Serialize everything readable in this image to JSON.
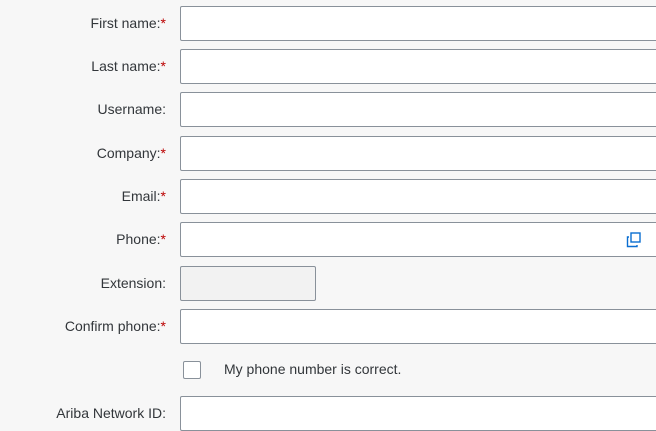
{
  "form": {
    "fields": [
      {
        "label": "First name:",
        "required": "*",
        "value": ""
      },
      {
        "label": "Last name:",
        "required": "*",
        "value": ""
      },
      {
        "label": "Username:",
        "required": "",
        "value": ""
      },
      {
        "label": "Company:",
        "required": "*",
        "value": ""
      },
      {
        "label": "Email:",
        "required": "*",
        "value": ""
      },
      {
        "label": "Phone:",
        "required": "*",
        "value": ""
      },
      {
        "label": "Extension:",
        "required": "",
        "value": ""
      },
      {
        "label": "Confirm phone:",
        "required": "*",
        "value": ""
      },
      {
        "label": "Ariba Network ID:",
        "required": "",
        "value": ""
      }
    ],
    "phone_icon": "copy-icon",
    "checkbox_label": "My phone number is correct.",
    "checkbox_checked": false
  },
  "colors": {
    "required": "#bb0000",
    "border": "#89919a",
    "accent": "#0a6ed1"
  }
}
